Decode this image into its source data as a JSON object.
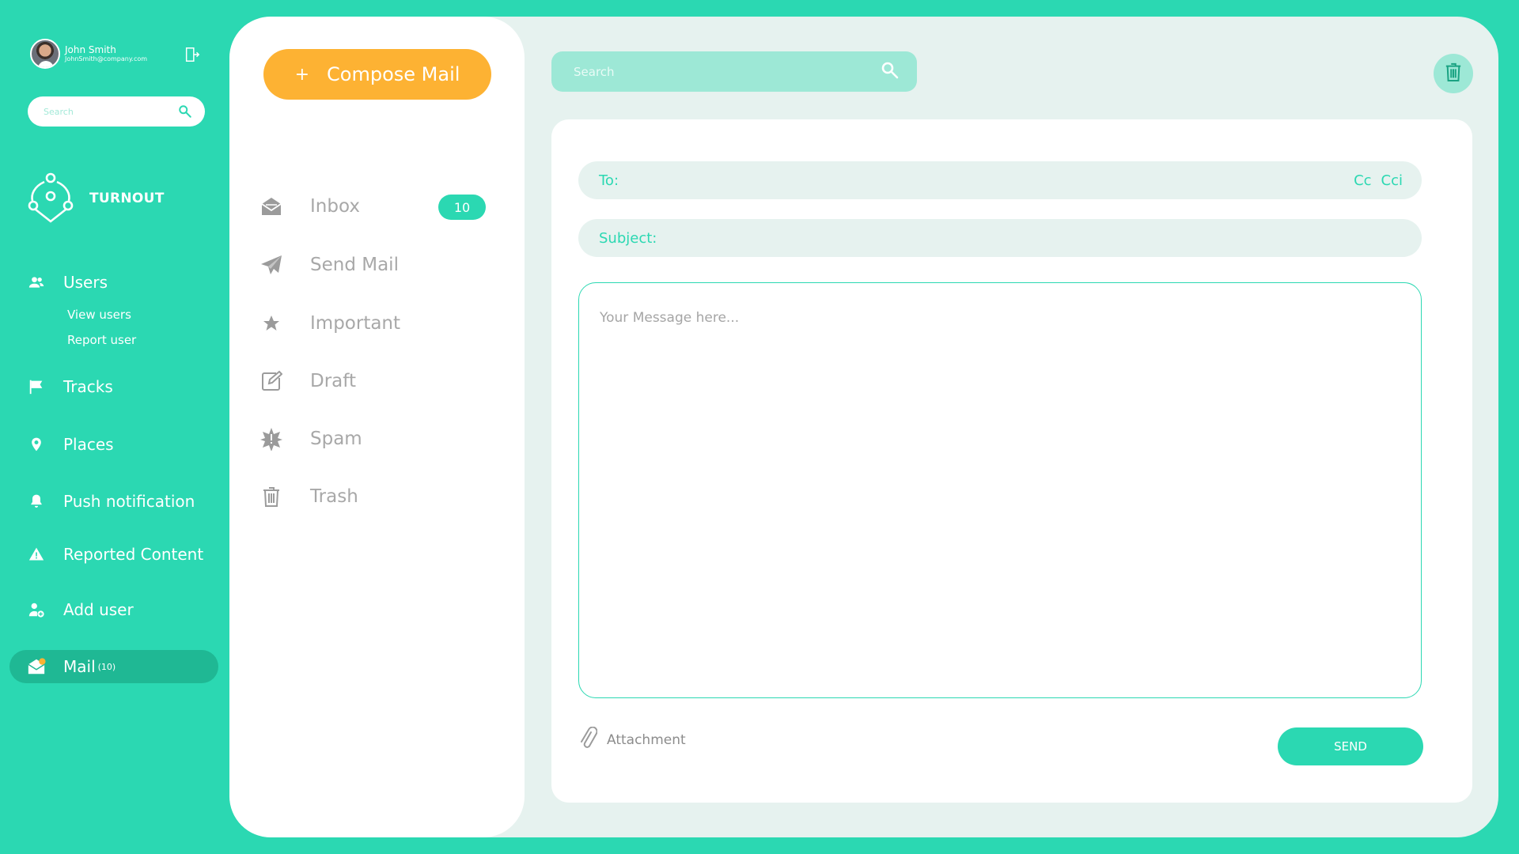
{
  "user": {
    "name": "John Smith",
    "email": "JohnSmith@company.com"
  },
  "sidebar_search": {
    "placeholder": "Search"
  },
  "brand": {
    "name": "TURNOUT"
  },
  "nav": {
    "users": "Users",
    "view_users": "View users",
    "report_user": "Report user",
    "tracks": "Tracks",
    "places": "Places",
    "push_notification": "Push notification",
    "reported_content": "Reported Content",
    "add_user": "Add user",
    "mail": "Mail",
    "mail_count": "(10)"
  },
  "compose_button": {
    "plus": "+",
    "label": "Compose Mail"
  },
  "folders": [
    {
      "label": "Inbox",
      "icon": "inbox-icon",
      "badge": "10"
    },
    {
      "label": "Send Mail",
      "icon": "paper-plane-icon"
    },
    {
      "label": "Important",
      "icon": "star-icon"
    },
    {
      "label": "Draft",
      "icon": "edit-icon"
    },
    {
      "label": "Spam",
      "icon": "spam-icon"
    },
    {
      "label": "Trash",
      "icon": "trash-icon"
    }
  ],
  "top_search": {
    "placeholder": "Search"
  },
  "compose": {
    "to_label": "To:",
    "cc_label": "Cc",
    "cci_label": "Cci",
    "subject_label": "Subject:",
    "message_placeholder": "Your Message here...",
    "attachment_label": "Attachment",
    "send_label": "SEND"
  },
  "colors": {
    "accent": "#2bd8b2",
    "accent_dark": "#1fb894",
    "compose": "#fdb233",
    "panel": "#e6f2ef",
    "muted_text": "#a8a8a8"
  }
}
